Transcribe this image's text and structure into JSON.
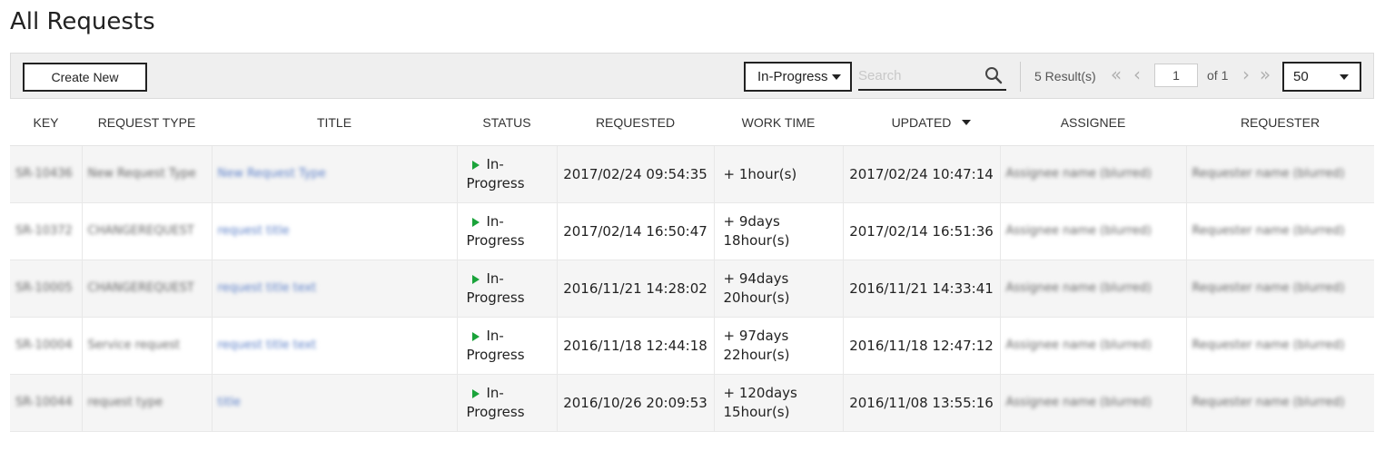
{
  "page": {
    "title": "All Requests"
  },
  "toolbar": {
    "create_label": "Create New",
    "status_filter": "In-Progress",
    "search_placeholder": "Search",
    "results": "5 Result(s)",
    "page_number": "1",
    "of_label": "of 1",
    "per_page": "50"
  },
  "table": {
    "headers": {
      "key": "KEY",
      "request_type": "REQUEST TYPE",
      "title": "TITLE",
      "status": "STATUS",
      "requested": "REQUESTED",
      "work_time": "WORK TIME",
      "updated": "UPDATED",
      "assignee": "ASSIGNEE",
      "requester": "REQUESTER"
    },
    "rows": [
      {
        "key": "SR-10436",
        "request_type": "New Request Type",
        "title": "New Request Type",
        "status": "In-Progress",
        "requested": "2017/02/24 09:54:35",
        "work_time": "+ 1hour(s)",
        "updated": "2017/02/24 10:47:14",
        "assignee": "Assignee name (blurred)",
        "requester": "Requester name (blurred)"
      },
      {
        "key": "SR-10372",
        "request_type": "CHANGEREQUEST",
        "title": "request title",
        "status": "In-Progress",
        "requested": "2017/02/14 16:50:47",
        "work_time": "+ 9days 18hour(s)",
        "updated": "2017/02/14 16:51:36",
        "assignee": "Assignee name (blurred)",
        "requester": "Requester name (blurred)"
      },
      {
        "key": "SR-10005",
        "request_type": "CHANGEREQUEST",
        "title": "request title text",
        "status": "In-Progress",
        "requested": "2016/11/21 14:28:02",
        "work_time": "+ 94days 20hour(s)",
        "updated": "2016/11/21 14:33:41",
        "assignee": "Assignee name (blurred)",
        "requester": "Requester name (blurred)"
      },
      {
        "key": "SR-10004",
        "request_type": "Service request",
        "title": "request title text",
        "status": "In-Progress",
        "requested": "2016/11/18 12:44:18",
        "work_time": "+ 97days 22hour(s)",
        "updated": "2016/11/18 12:47:12",
        "assignee": "Assignee name (blurred)",
        "requester": "Requester name (blurred)"
      },
      {
        "key": "SR-10044",
        "request_type": "request type",
        "title": "title",
        "status": "In-Progress",
        "requested": "2016/10/26 20:09:53",
        "work_time": "+ 120days 15hour(s)",
        "updated": "2016/11/08 13:55:16",
        "assignee": "Assignee name (blurred)",
        "requester": "Requester name (blurred)"
      }
    ]
  },
  "colors": {
    "status_play": "#1aa33a",
    "link": "#5b7fc7",
    "toolbar_bg": "#efefef"
  }
}
